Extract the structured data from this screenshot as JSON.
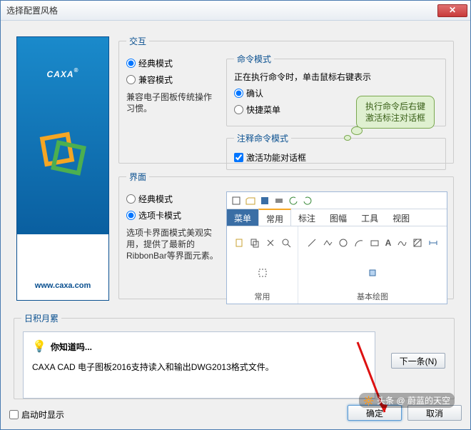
{
  "window": {
    "title": "选择配置风格"
  },
  "close": "✕",
  "sidebar": {
    "brand": "CAXA",
    "reg": "®",
    "url": "www.caxa.com"
  },
  "jiaohu": {
    "legend": "交互",
    "radio_classic": "经典模式",
    "radio_compat": "兼容模式",
    "note": "兼容电子图板传统操作习惯。",
    "cmd": {
      "legend": "命令模式",
      "desc": "正在执行命令时，单击鼠标右键表示",
      "r_confirm": "确认",
      "r_quick": "快捷菜单"
    },
    "annot": {
      "legend": "注释命令模式",
      "chk": "激活功能对话框"
    }
  },
  "callout": {
    "line1": "执行命令后右键",
    "line2": "激活标注对话框"
  },
  "jiemian": {
    "legend": "界面",
    "r_classic": "经典模式",
    "r_tab": "选项卡模式",
    "note": "选项卡界面模式美观实用，提供了最新的RibbonBar等界面元素。",
    "tabs": {
      "menu": "菜单",
      "common": "常用",
      "annot": "标注",
      "frame": "图幅",
      "tool": "工具",
      "view": "视图"
    },
    "group1": "常用",
    "group2": "基本绘图"
  },
  "tip": {
    "legend": "日积月累",
    "head": "你知道吗...",
    "body": "CAXA CAD 电子图板2016支持读入和输出DWG2013格式文件。",
    "next": "下一条(N)"
  },
  "footer": {
    "startup": "启动时显示",
    "ok": "确定",
    "cancel": "取消"
  },
  "watermark": "头条 @ 蔚蓝的天空"
}
